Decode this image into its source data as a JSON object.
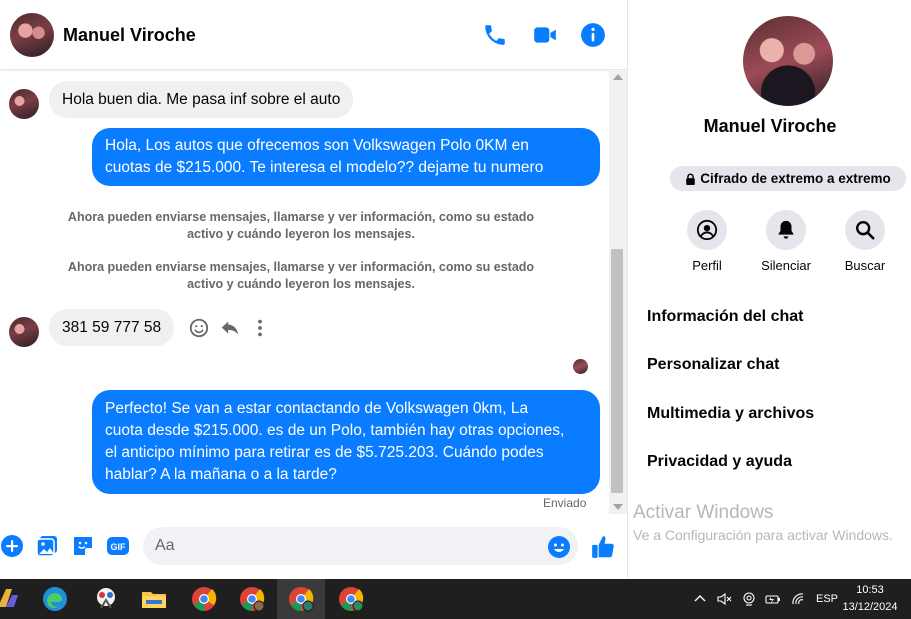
{
  "header": {
    "contact_name": "Manuel Viroche",
    "icons": [
      "phone-icon",
      "video-call-icon",
      "info-icon"
    ],
    "accent_color": "#0a7cff"
  },
  "messages": {
    "incoming_1": "Hola buen dia. Me pasa inf sobre el auto",
    "outgoing_1_line1": "Hola, Los autos que ofrecemos son Volkswagen Polo 0KM en",
    "outgoing_1_line2": "cuotas de $215.000. Te interesa el modelo?? dejame tu numero",
    "system_1_line1": "Ahora pueden enviarse mensajes, llamarse y ver información, como su estado",
    "system_1_line2": "activo y cuándo leyeron los mensajes.",
    "system_2_line1": "Ahora pueden enviarse mensajes, llamarse y ver información, como su estado",
    "system_2_line2": "activo y cuándo leyeron los mensajes.",
    "incoming_2": "381 59 777 58",
    "outgoing_2_line1": "Perfecto!  Se van a estar contactando de Volkswagen 0km, La",
    "outgoing_2_line2": "cuota desde $215.000. es de un Polo, también hay otras opciones,",
    "outgoing_2_line3": "el anticipo mínimo para retirar es de $5.725.203. Cuándo podes",
    "outgoing_2_line4": "hablar? A la mañana o a la tarde?",
    "status": "Enviado"
  },
  "composer": {
    "placeholder": "Aa",
    "icons": [
      "plus-icon",
      "photo-icon",
      "sticker-icon",
      "gif-icon",
      "emoji-icon",
      "like-icon"
    ],
    "gif_label": "GIF"
  },
  "info_panel": {
    "name": "Manuel Viroche",
    "encryption": "Cifrado de extremo a extremo",
    "actions": [
      {
        "label": "Perfil",
        "icon": "profile-icon"
      },
      {
        "label": "Silenciar",
        "icon": "bell-icon"
      },
      {
        "label": "Buscar",
        "icon": "search-icon"
      }
    ],
    "menu": [
      "Información del chat",
      "Personalizar chat",
      "Multimedia y archivos",
      "Privacidad y ayuda"
    ]
  },
  "watermark": {
    "title": "Activar Windows",
    "subtitle": "Ve a Configuración para activar Windows."
  },
  "taskbar": {
    "language": "ESP",
    "time": "10:53",
    "date": "13/12/2024"
  }
}
